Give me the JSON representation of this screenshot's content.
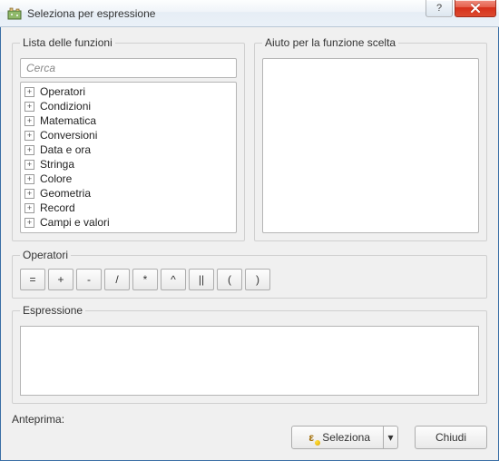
{
  "window": {
    "title": "Seleziona per espressione",
    "help_symbol": "?",
    "close_symbol": "×"
  },
  "functions": {
    "legend": "Lista delle funzioni",
    "search_placeholder": "Cerca",
    "items": [
      "Operatori",
      "Condizioni",
      "Matematica",
      "Conversioni",
      "Data e ora",
      "Stringa",
      "Colore",
      "Geometria",
      "Record",
      "Campi e valori"
    ]
  },
  "help_panel": {
    "legend": "Aiuto per la funzione scelta"
  },
  "operators": {
    "legend": "Operatori",
    "buttons": [
      "=",
      "+",
      "-",
      "/",
      "*",
      "^",
      "||",
      "(",
      ")"
    ]
  },
  "expression": {
    "legend": "Espressione",
    "value": ""
  },
  "preview": {
    "label": "Anteprima:"
  },
  "footer": {
    "select_label": "Seleziona",
    "close_label": "Chiudi",
    "select_dropdown_symbol": "▾"
  }
}
